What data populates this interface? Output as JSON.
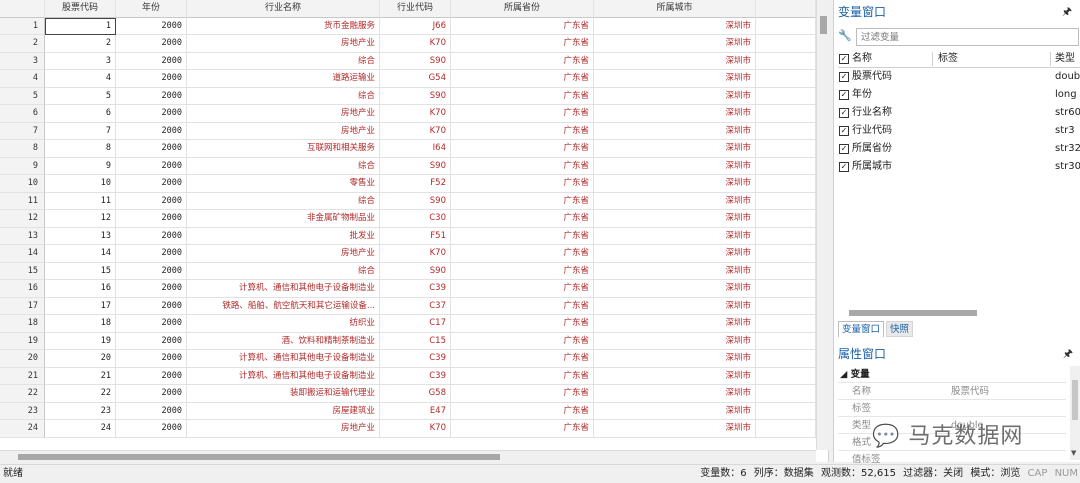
{
  "grid": {
    "headers": [
      "股票代码",
      "年份",
      "行业名称",
      "行业代码",
      "所属省份",
      "所属城市"
    ],
    "rows": [
      {
        "n": "1",
        "code": "1",
        "year": "2000",
        "industry": "货币金融服务",
        "icode": "J66",
        "prov": "广东省",
        "city": "深圳市"
      },
      {
        "n": "2",
        "code": "2",
        "year": "2000",
        "industry": "房地产业",
        "icode": "K70",
        "prov": "广东省",
        "city": "深圳市"
      },
      {
        "n": "3",
        "code": "3",
        "year": "2000",
        "industry": "综合",
        "icode": "S90",
        "prov": "广东省",
        "city": "深圳市"
      },
      {
        "n": "4",
        "code": "4",
        "year": "2000",
        "industry": "道路运输业",
        "icode": "G54",
        "prov": "广东省",
        "city": "深圳市"
      },
      {
        "n": "5",
        "code": "5",
        "year": "2000",
        "industry": "综合",
        "icode": "S90",
        "prov": "广东省",
        "city": "深圳市"
      },
      {
        "n": "6",
        "code": "6",
        "year": "2000",
        "industry": "房地产业",
        "icode": "K70",
        "prov": "广东省",
        "city": "深圳市"
      },
      {
        "n": "7",
        "code": "7",
        "year": "2000",
        "industry": "房地产业",
        "icode": "K70",
        "prov": "广东省",
        "city": "深圳市"
      },
      {
        "n": "8",
        "code": "8",
        "year": "2000",
        "industry": "互联网和相关服务",
        "icode": "I64",
        "prov": "广东省",
        "city": "深圳市"
      },
      {
        "n": "9",
        "code": "9",
        "year": "2000",
        "industry": "综合",
        "icode": "S90",
        "prov": "广东省",
        "city": "深圳市"
      },
      {
        "n": "10",
        "code": "10",
        "year": "2000",
        "industry": "零售业",
        "icode": "F52",
        "prov": "广东省",
        "city": "深圳市"
      },
      {
        "n": "11",
        "code": "11",
        "year": "2000",
        "industry": "综合",
        "icode": "S90",
        "prov": "广东省",
        "city": "深圳市"
      },
      {
        "n": "12",
        "code": "12",
        "year": "2000",
        "industry": "非金属矿物制品业",
        "icode": "C30",
        "prov": "广东省",
        "city": "深圳市"
      },
      {
        "n": "13",
        "code": "13",
        "year": "2000",
        "industry": "批发业",
        "icode": "F51",
        "prov": "广东省",
        "city": "深圳市"
      },
      {
        "n": "14",
        "code": "14",
        "year": "2000",
        "industry": "房地产业",
        "icode": "K70",
        "prov": "广东省",
        "city": "深圳市"
      },
      {
        "n": "15",
        "code": "15",
        "year": "2000",
        "industry": "综合",
        "icode": "S90",
        "prov": "广东省",
        "city": "深圳市"
      },
      {
        "n": "16",
        "code": "16",
        "year": "2000",
        "industry": "计算机、通信和其他电子设备制造业",
        "icode": "C39",
        "prov": "广东省",
        "city": "深圳市"
      },
      {
        "n": "17",
        "code": "17",
        "year": "2000",
        "industry": "铁路、船舶、航空航天和其它运输设备...",
        "icode": "C37",
        "prov": "广东省",
        "city": "深圳市"
      },
      {
        "n": "18",
        "code": "18",
        "year": "2000",
        "industry": "纺织业",
        "icode": "C17",
        "prov": "广东省",
        "city": "深圳市"
      },
      {
        "n": "19",
        "code": "19",
        "year": "2000",
        "industry": "酒、饮料和精制茶制造业",
        "icode": "C15",
        "prov": "广东省",
        "city": "深圳市"
      },
      {
        "n": "20",
        "code": "20",
        "year": "2000",
        "industry": "计算机、通信和其他电子设备制造业",
        "icode": "C39",
        "prov": "广东省",
        "city": "深圳市"
      },
      {
        "n": "21",
        "code": "21",
        "year": "2000",
        "industry": "计算机、通信和其他电子设备制造业",
        "icode": "C39",
        "prov": "广东省",
        "city": "深圳市"
      },
      {
        "n": "22",
        "code": "22",
        "year": "2000",
        "industry": "装卸搬运和运输代理业",
        "icode": "G58",
        "prov": "广东省",
        "city": "深圳市"
      },
      {
        "n": "23",
        "code": "23",
        "year": "2000",
        "industry": "房屋建筑业",
        "icode": "E47",
        "prov": "广东省",
        "city": "深圳市"
      },
      {
        "n": "24",
        "code": "24",
        "year": "2000",
        "industry": "房地产业",
        "icode": "K70",
        "prov": "广东省",
        "city": "深圳市"
      }
    ]
  },
  "variables_window": {
    "title": "变量窗口",
    "pin_icon": "pin-icon",
    "filter_placeholder": "过滤变量",
    "headers": {
      "name": "名称",
      "label": "标签",
      "type": "类型"
    },
    "variables": [
      {
        "name": "股票代码",
        "label": "",
        "type": "double"
      },
      {
        "name": "年份",
        "label": "",
        "type": "long"
      },
      {
        "name": "行业名称",
        "label": "",
        "type": "str60"
      },
      {
        "name": "行业代码",
        "label": "",
        "type": "str3"
      },
      {
        "name": "所属省份",
        "label": "",
        "type": "str32"
      },
      {
        "name": "所属城市",
        "label": "",
        "type": "str30"
      }
    ]
  },
  "tabs": [
    "变量窗口",
    "快照"
  ],
  "properties_window": {
    "title": "属性窗口",
    "group": "变量",
    "rows": [
      {
        "key": "名称",
        "value": "股票代码"
      },
      {
        "key": "标签",
        "value": ""
      },
      {
        "key": "类型",
        "value": "double"
      },
      {
        "key": "格式",
        "value": ""
      },
      {
        "key": "值标签",
        "value": ""
      }
    ]
  },
  "watermark": "马克数据网",
  "statusbar": {
    "left": "就绪",
    "vars": "变量数：6",
    "order": "列序：数据集",
    "obs": "观测数：52,615",
    "filter": "过滤器：关闭",
    "mode": "模式：浏览",
    "cap": "CAP",
    "num": "NUM"
  },
  "colors": {
    "string_value": "#b22a2a",
    "title_blue": "#1a5fa8"
  }
}
